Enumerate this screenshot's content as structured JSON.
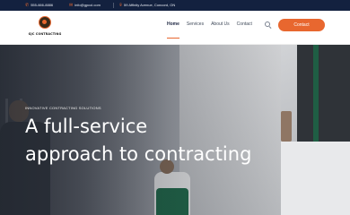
{
  "topbar": {
    "phone": "555-666-8886",
    "email": "info@gpcol.com",
    "address": "59 Affinity Avenue, Concord, ON",
    "phone_icon": "phone-icon",
    "email_icon": "email-icon",
    "address_icon": "map-pin-icon"
  },
  "header": {
    "logo_text": "GJC CONTRACTING",
    "nav": [
      "Home",
      "Services",
      "About Us",
      "Contact"
    ],
    "active_nav": "Home",
    "search_icon": "search-icon",
    "cta_label": "Contact"
  },
  "hero": {
    "tagline": "INNOVATIVE CONTRACTING SOLUTIONS",
    "title_line1": "A full-service",
    "title_line2": "approach to contracting"
  },
  "colors": {
    "topbar_bg": "#13213f",
    "accent": "#e8672f",
    "nav_text": "#404a5a"
  }
}
